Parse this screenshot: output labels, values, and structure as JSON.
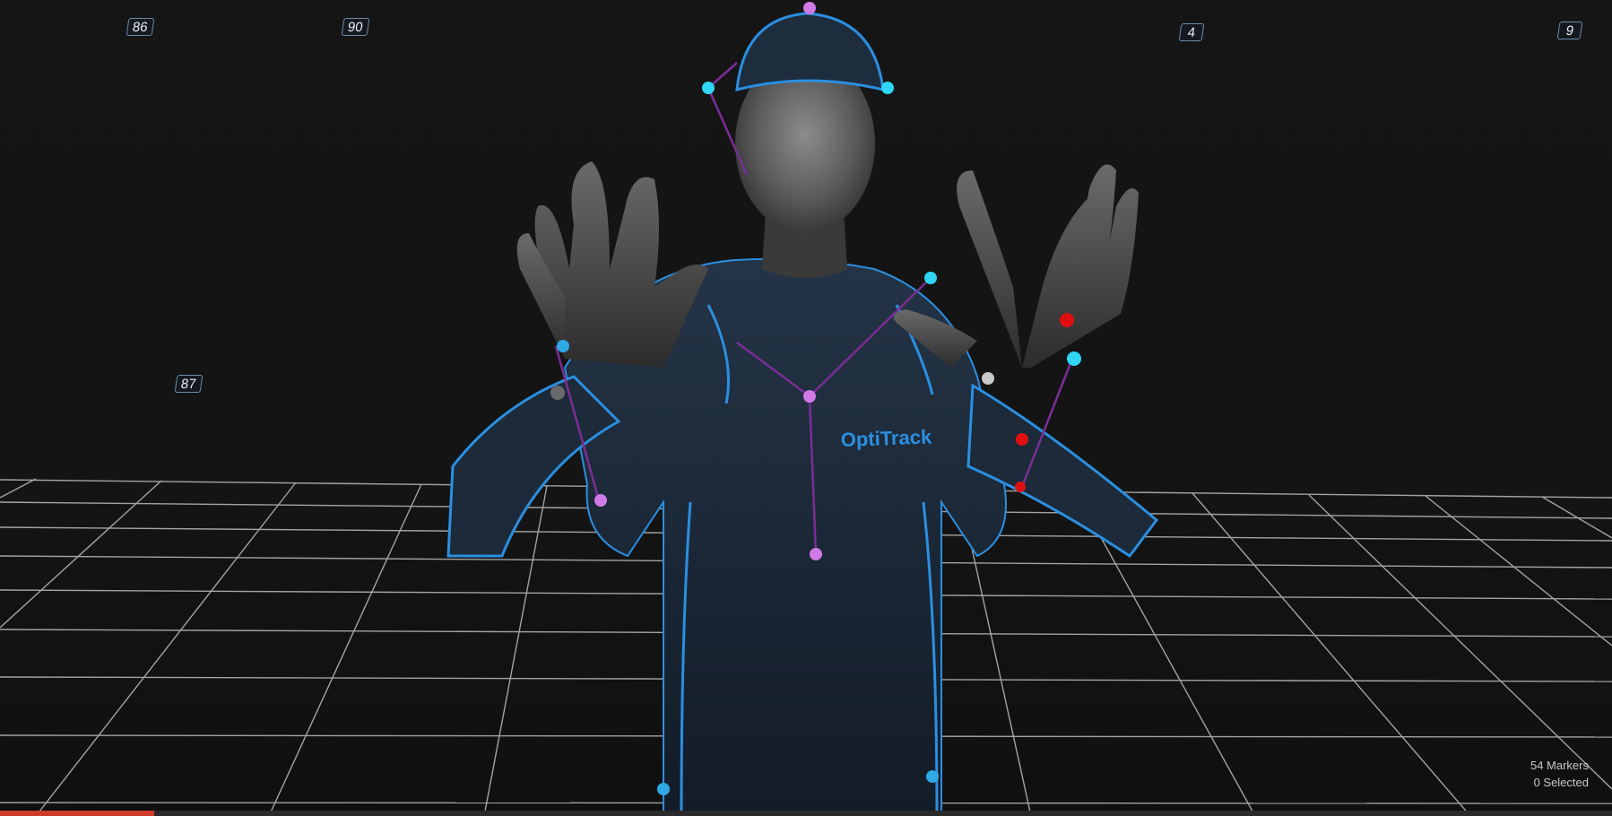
{
  "viewport": {
    "camera_labels": [
      "86",
      "90",
      "4",
      "9",
      "87"
    ],
    "status": {
      "markers": "54 Markers",
      "selected": "0 Selected"
    }
  },
  "suit": {
    "logo": "OptiTrack"
  },
  "colors": {
    "background": "#151515",
    "grid": "#bdbdbd",
    "suit": "#1c2a3a",
    "suit_trim": "#2b8fe0",
    "marker_cyan": "#2fd6f5",
    "marker_violet": "#d07ae6",
    "marker_red": "#e01010",
    "marker_gray": "#c9c9c9",
    "bone_line": "#7a2e95"
  },
  "icons": [
    "camera-icon",
    "marker-icon"
  ]
}
